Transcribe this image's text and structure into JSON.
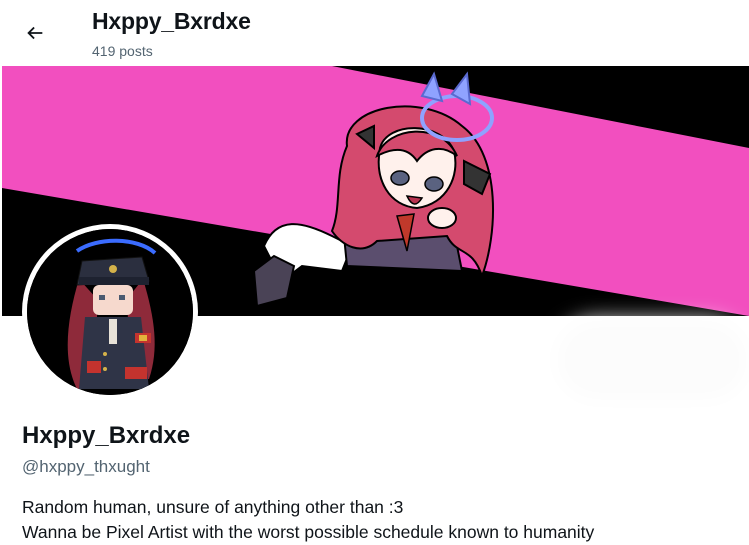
{
  "header": {
    "back_icon": "arrow-left-icon",
    "title": "Hxppy_Bxrdxe",
    "post_count": "419 posts"
  },
  "banner": {
    "description_colors": {
      "pink": "#f24fbf",
      "black": "#000000",
      "halo": "#8fa2ff",
      "hair": "#d44a6e"
    }
  },
  "profile": {
    "display_name": "Hxppy_Bxrdxe",
    "handle": "@hxppy_thxught",
    "bio_lines": [
      "Random human, unsure of anything other than :3",
      "Wanna be Pixel Artist with the worst possible schedule known to humanity"
    ]
  },
  "colors": {
    "text": "#0f1419",
    "muted": "#536471"
  }
}
